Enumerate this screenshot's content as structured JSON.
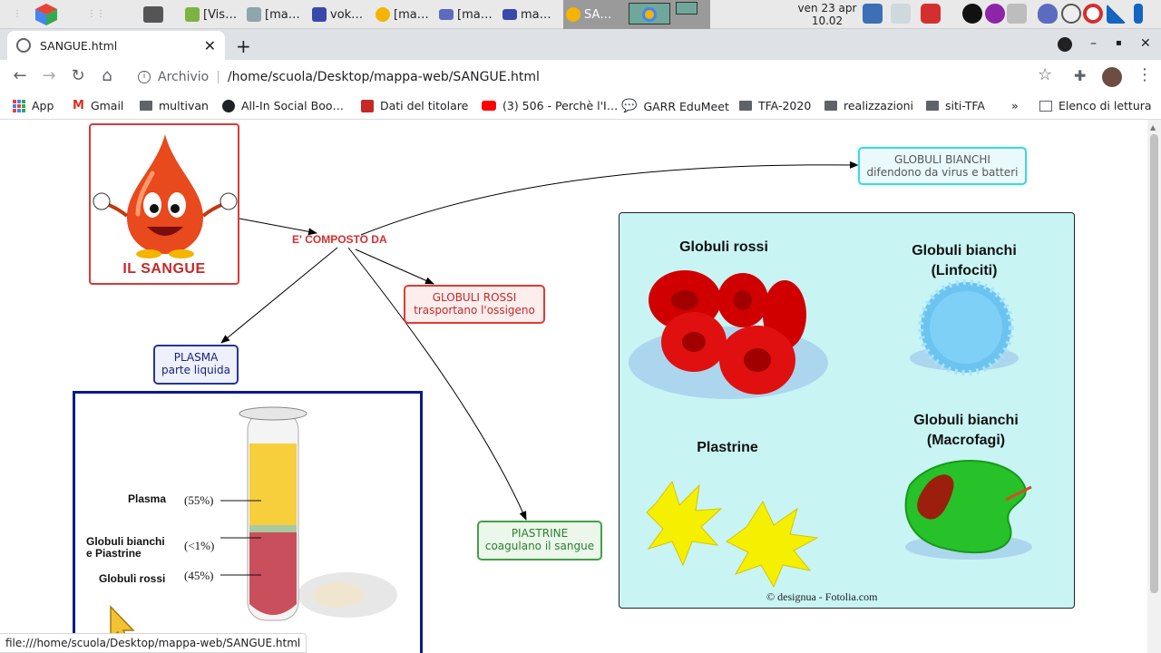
{
  "taskbar": {
    "tasks": [
      {
        "label": "[Vis…"
      },
      {
        "label": "[ma…"
      },
      {
        "label": "vok…"
      },
      {
        "label": "[ma…"
      },
      {
        "label": "[ma…"
      },
      {
        "label": "ma…"
      },
      {
        "label": "SA…"
      }
    ],
    "clock": {
      "date": "ven 23 apr",
      "time": "10.02"
    }
  },
  "browser": {
    "tab_title": "SANGUE.html",
    "address_scheme": "Archivio",
    "address_path": "/home/scuola/Desktop/mappa-web/SANGUE.html",
    "bookmarks": [
      {
        "label": "App",
        "icon": "apps-icon"
      },
      {
        "label": "Gmail",
        "icon": "gmail-icon"
      },
      {
        "label": "multivan",
        "icon": "folder-icon"
      },
      {
        "label": "All-In Social Boo…",
        "icon": "social-icon"
      },
      {
        "label": "Dati del titolare",
        "icon": "doc-icon"
      },
      {
        "label": "(3) 506 - Perchè l'I…",
        "icon": "youtube-icon"
      },
      {
        "label": "GARR EduMeet",
        "icon": "chat-icon"
      },
      {
        "label": "TFA-2020",
        "icon": "folder-icon"
      },
      {
        "label": "realizzazioni",
        "icon": "folder-icon"
      },
      {
        "label": "siti-TFA",
        "icon": "folder-icon"
      }
    ],
    "bookmarks_more": "»",
    "reading_list": "Elenco di lettura",
    "status_url": "file:///home/scuola/Desktop/mappa-web/SANGUE.html"
  },
  "map": {
    "root_label": "IL SANGUE",
    "link_label": "E' COMPOSTO DA",
    "nodes": {
      "globuli_bianchi": {
        "title": "GLOBULI BIANCHI",
        "desc": "difendono da virus e batteri",
        "color": "#4dd0e1"
      },
      "globuli_rossi": {
        "title": "GLOBULI ROSSI",
        "desc": "trasportano l'ossigeno",
        "color": "#e53935"
      },
      "plasma": {
        "title": "PLASMA",
        "desc": "parte liquida",
        "color": "#283593"
      },
      "piastrine": {
        "title": "PIASTRINE",
        "desc": "coagulano il sangue",
        "color": "#43a047"
      }
    },
    "tube_image": {
      "labels": [
        {
          "name": "Plasma",
          "pct": "(55%)"
        },
        {
          "name": "Globuli bianchi\ne Piastrine",
          "pct": "(<1%)"
        },
        {
          "name": "Globuli rossi",
          "pct": "(45%)"
        }
      ]
    },
    "cells_image": {
      "rossi": "Globuli rossi",
      "linfociti": "Globuli bianchi\n(Linfociti)",
      "piastrine": "Plastrine",
      "macrofagi": "Globuli bianchi\n(Macrofagi)",
      "credit": "© designua - Fotolia.com"
    }
  }
}
